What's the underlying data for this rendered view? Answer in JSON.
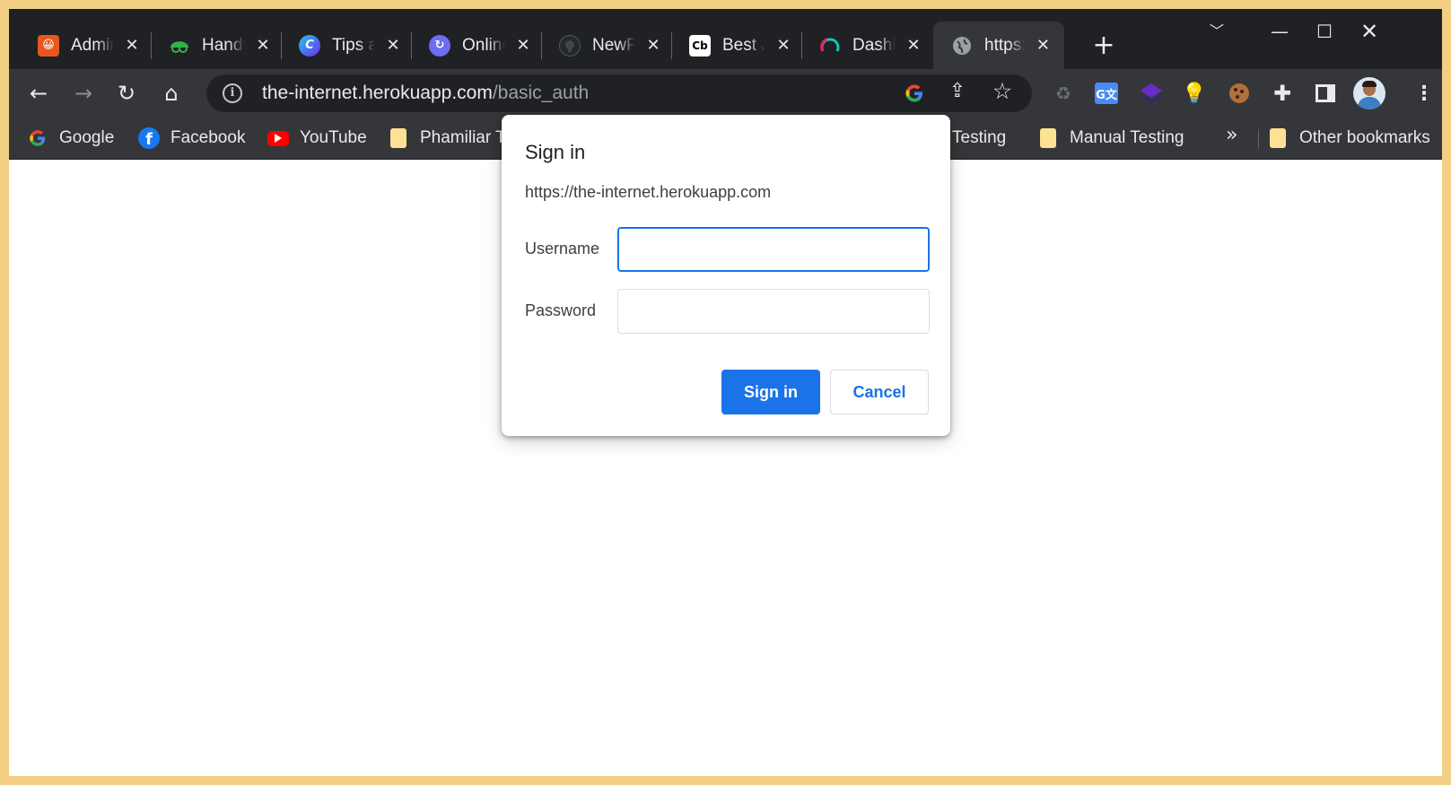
{
  "tabs": [
    {
      "title": "Admin",
      "favicon_color": "#e8571d",
      "icon": "admin-favicon"
    },
    {
      "title": "Handy",
      "favicon_color": "#2fb34a",
      "icon": "glasses-favicon"
    },
    {
      "title": "Tips a",
      "favicon_color": "#5b3ef0",
      "icon": "c-favicon"
    },
    {
      "title": "Online",
      "favicon_color": "#6b6ef0",
      "icon": "sync-favicon"
    },
    {
      "title": "NewP",
      "favicon_color": "#24292f",
      "icon": "github-favicon"
    },
    {
      "title": "Best J",
      "favicon_color": "#ffffff",
      "icon": "cb-favicon"
    },
    {
      "title": "Dashb",
      "favicon_color": "#e91e63",
      "icon": "dashboard-favicon"
    },
    {
      "title": "https:",
      "favicon_color": "#9aa0a6",
      "icon": "globe-favicon",
      "active": true
    }
  ],
  "omnibox": {
    "host": "the-internet.herokuapp.com",
    "path": "/basic_auth"
  },
  "bookmarks": [
    {
      "label": "Google",
      "icon": "google-icon"
    },
    {
      "label": "Facebook",
      "icon": "facebook-icon"
    },
    {
      "label": "YouTube",
      "icon": "youtube-icon"
    },
    {
      "label": "Phamiliar T",
      "icon": "folder-icon"
    },
    {
      "label": "Testing",
      "icon": "folder-icon"
    },
    {
      "label": "Manual Testing",
      "icon": "folder-icon"
    },
    {
      "label": "Other bookmarks",
      "icon": "folder-icon"
    }
  ],
  "dialog": {
    "title": "Sign in",
    "origin": "https://the-internet.herokuapp.com",
    "username_label": "Username",
    "username_value": "",
    "password_label": "Password",
    "password_value": "",
    "signin_label": "Sign in",
    "cancel_label": "Cancel"
  },
  "colors": {
    "accent": "#1a73e8",
    "chrome_dark": "#202124",
    "toolbar": "#35363a"
  }
}
